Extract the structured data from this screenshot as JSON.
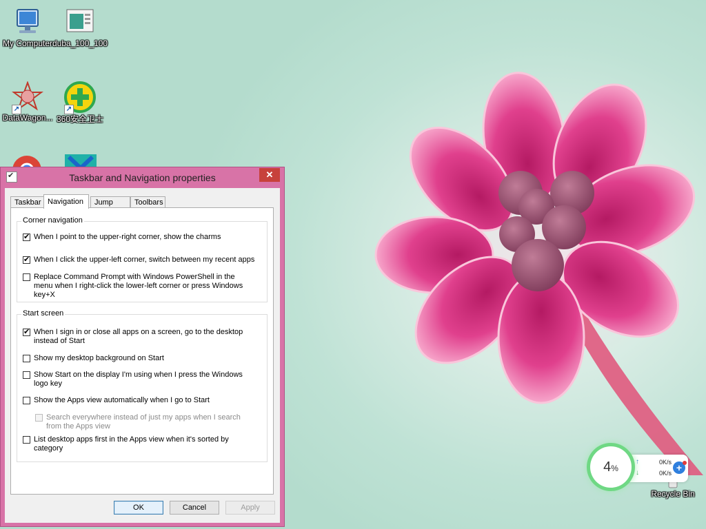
{
  "desktop": {
    "icons": [
      {
        "label": "My Computer",
        "icon": "computer-icon"
      },
      {
        "label": "duba_100_100",
        "icon": "document-image-icon"
      },
      {
        "label": "DataWagon...",
        "icon": "datawagon-app-icon"
      },
      {
        "label": "360安全卫士",
        "icon": "360-security-icon"
      },
      {
        "label": "Recycle Bin",
        "icon": "recycle-bin-icon"
      }
    ]
  },
  "dialog": {
    "title": "Taskbar and Navigation properties",
    "close_label": "✕",
    "tabs": [
      {
        "label": "Taskbar",
        "active": false
      },
      {
        "label": "Navigation",
        "active": true
      },
      {
        "label": "Jump Lists",
        "active": false
      },
      {
        "label": "Toolbars",
        "active": false
      }
    ],
    "corner_navigation": {
      "legend": "Corner navigation",
      "options": [
        {
          "label": "When I point to the upper-right corner, show the charms",
          "checked": true
        },
        {
          "label": "When I click the upper-left corner, switch between my recent apps",
          "checked": true
        },
        {
          "label": "Replace Command Prompt with Windows PowerShell in the menu when I right-click the lower-left corner or press Windows key+X",
          "checked": false
        }
      ]
    },
    "start_screen": {
      "legend": "Start screen",
      "options": [
        {
          "label": "When I sign in or close all apps on a screen, go to the desktop instead of Start",
          "checked": true,
          "disabled": false
        },
        {
          "label": "Show my desktop background on Start",
          "checked": false,
          "disabled": false
        },
        {
          "label": "Show Start on the display I'm using when I press the Windows logo key",
          "checked": false,
          "disabled": false
        },
        {
          "label": "Show the Apps view automatically when I go to Start",
          "checked": false,
          "disabled": false
        },
        {
          "label": "Search everywhere instead of just my apps when I search from the Apps view",
          "checked": false,
          "disabled": true
        },
        {
          "label": "List desktop apps first in the Apps view when it's sorted by category",
          "checked": false,
          "disabled": false
        }
      ]
    },
    "buttons": {
      "ok": "OK",
      "cancel": "Cancel",
      "apply": "Apply"
    }
  },
  "net_widget": {
    "cpu_value": "4",
    "cpu_unit": "%",
    "upload": "0K/s",
    "download": "0K/s",
    "colors": {
      "ring": "#6fd884",
      "plus": "#2f7fde"
    }
  },
  "colors": {
    "window_frame": "#d873a7",
    "close_button": "#c7413b"
  }
}
